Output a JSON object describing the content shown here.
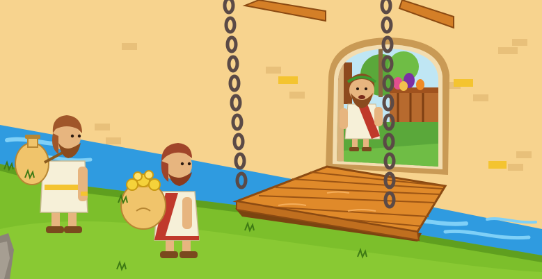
{
  "scene": {
    "title": "",
    "colors": {
      "wall": "#f7d38e",
      "wall_shadow": "#e9bf72",
      "brick": "#e8b865",
      "brick_yellow": "#f4c430",
      "river": "#2f9be0",
      "river_light": "#7fd0f7",
      "grass": "#7cbf2b",
      "grass_dark": "#4f8f1c",
      "wood": "#e08a2a",
      "wood_dark": "#9b5414",
      "chain": "#5b4a46",
      "tunic": "#f6f0d8",
      "sash": "#c0392b"
    },
    "icons": [
      "drawbridge-icon",
      "chain-icon",
      "doorway-icon",
      "merchant-icon",
      "traveler-icon",
      "gold-sack-icon",
      "water-jug-icon",
      "river-icon"
    ]
  }
}
